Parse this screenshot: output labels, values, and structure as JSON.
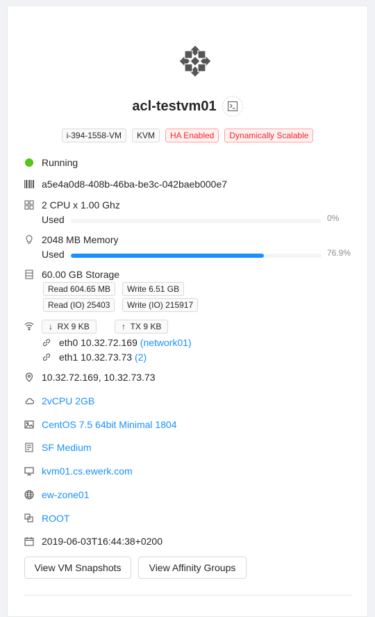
{
  "vm": {
    "name": "acl-testvm01",
    "tags": [
      {
        "label": "i-394-1558-VM",
        "style": "default"
      },
      {
        "label": "KVM",
        "style": "default"
      },
      {
        "label": "HA Enabled",
        "style": "red"
      },
      {
        "label": "Dynamically Scalable",
        "style": "red"
      }
    ],
    "status": "Running",
    "status_color": "#52c41a",
    "uuid": "a5e4a0d8-408b-46ba-be3c-042baeb000e7",
    "cpu": {
      "label": "2 CPU x 1.00 Ghz",
      "used_label": "Used",
      "used_pct_text": "0%",
      "used_fraction": 0.0
    },
    "memory": {
      "label": "2048 MB Memory",
      "used_label": "Used",
      "used_pct_text": "76.9%",
      "used_fraction": 0.769
    },
    "storage": {
      "label": "60.00 GB Storage",
      "read": "Read 604.65 MB",
      "write": "Write 6.51 GB",
      "read_io": "Read (IO) 25403",
      "write_io": "Write (IO) 215917"
    },
    "network": {
      "rx": "RX 9 KB",
      "tx": "TX 9 KB",
      "nics": [
        {
          "name": "eth0 10.32.72.169",
          "network": "(network01)"
        },
        {
          "name": "eth1 10.32.73.73",
          "network": "(2)"
        }
      ]
    },
    "ip_addresses": "10.32.72.169, 10.32.73.73",
    "service_offering": "2vCPU 2GB",
    "template": "CentOS 7.5 64bit Minimal 1804",
    "disk_offering": "SF Medium",
    "host": "kvm01.cs.ewerk.com",
    "zone": "ew-zone01",
    "domain": "ROOT",
    "created": "2019-06-03T16:44:38+0200"
  },
  "actions": {
    "snapshots": "View VM Snapshots",
    "affinity": "View Affinity Groups"
  },
  "colors": {
    "accent": "#1890ff",
    "danger": "#f5222d",
    "success": "#52c41a"
  }
}
